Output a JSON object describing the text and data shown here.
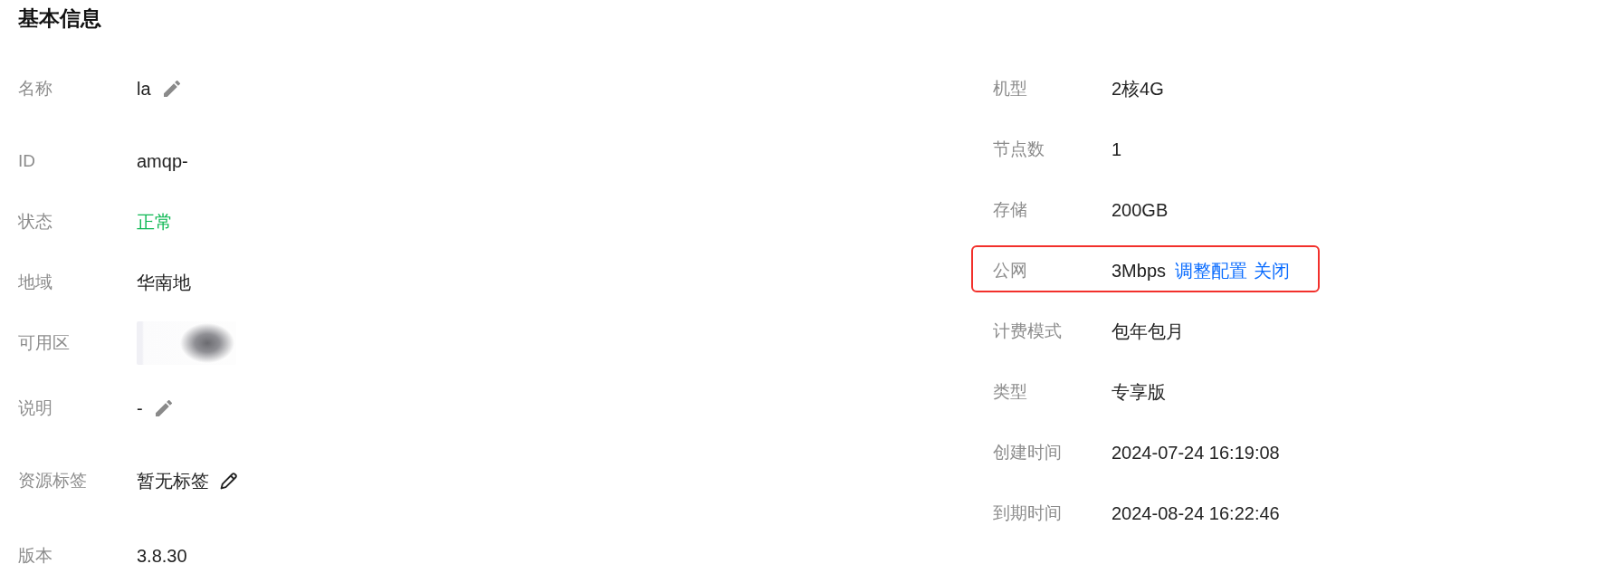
{
  "title": "基本信息",
  "left_fields": [
    {
      "kind": "editable",
      "label": "名称",
      "value": "la",
      "highlighted": false
    },
    {
      "kind": "plain",
      "label": "ID",
      "value": "amqp-",
      "highlighted": false
    },
    {
      "kind": "status",
      "label": "状态",
      "value": "正常",
      "highlighted": false
    },
    {
      "kind": "plain",
      "label": "地域",
      "value": "华南地",
      "highlighted": false
    },
    {
      "kind": "redacted",
      "label": "可用区",
      "highlighted": false
    },
    {
      "kind": "editable",
      "label": "说明",
      "value": "-",
      "highlighted": false
    },
    {
      "kind": "tags",
      "label": "资源标签",
      "value": "暂无标签",
      "highlighted": false
    },
    {
      "kind": "plain",
      "label": "版本",
      "value": "3.8.30",
      "highlighted": false
    }
  ],
  "right_fields": [
    {
      "kind": "plain",
      "label": "机型",
      "value": "2核4G",
      "highlighted": false
    },
    {
      "kind": "plain",
      "label": "节点数",
      "value": "1",
      "highlighted": false
    },
    {
      "kind": "plain",
      "label": "存储",
      "value": "200GB",
      "highlighted": false
    },
    {
      "kind": "links",
      "label": "公网",
      "value": "3Mbps",
      "links": [
        "调整配置",
        "关闭"
      ],
      "highlighted": true
    },
    {
      "kind": "plain",
      "label": "计费模式",
      "value": "包年包月",
      "highlighted": false
    },
    {
      "kind": "plain",
      "label": "类型",
      "value": "专享版",
      "highlighted": false
    },
    {
      "kind": "plain",
      "label": "创建时间",
      "value": "2024-07-24 16:19:08",
      "highlighted": false
    },
    {
      "kind": "plain",
      "label": "到期时间",
      "value": "2024-08-24 16:22:46",
      "highlighted": false
    }
  ]
}
